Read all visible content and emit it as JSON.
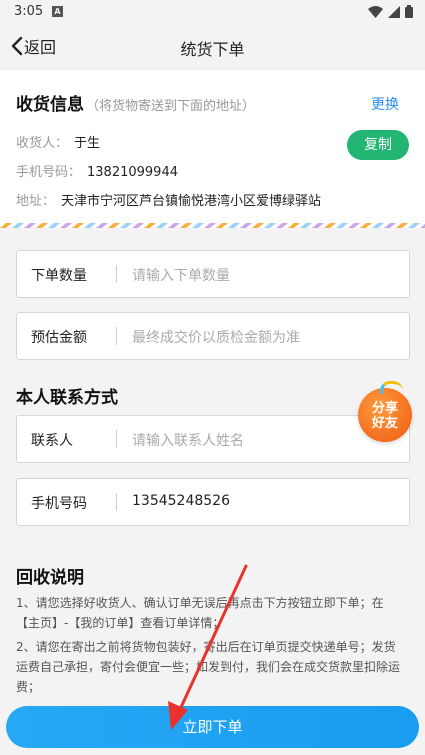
{
  "status_bar": {
    "time": "3:05",
    "app_icon_glyph": "A"
  },
  "nav": {
    "back_label": "返回",
    "title": "统货下单"
  },
  "address": {
    "heading": "收货信息",
    "hint": "（将货物寄送到下面的地址）",
    "change_label": "更换",
    "receiver_label": "收货人：",
    "receiver_value": "于生",
    "phone_label": "手机号码：",
    "phone_value": "13821099944",
    "address_label": "地址：",
    "address_value": "天津市宁河区芦台镇愉悦港湾小区爱博绿驿站",
    "copy_label": "复制"
  },
  "order": {
    "quantity_label": "下单数量",
    "quantity_placeholder": "请输入下单数量",
    "amount_label": "预估金额",
    "amount_placeholder": "最终成交价以质检金额为准"
  },
  "contact": {
    "heading": "本人联系方式",
    "name_label": "联系人",
    "name_placeholder": "请输入联系人姓名",
    "phone_label": "手机号码",
    "phone_value": "13545248526"
  },
  "share_badge": {
    "line1": "分享",
    "line2": "好友"
  },
  "notes": {
    "heading": "回收说明",
    "item1": "1、请您选择好收货人、确认订单无误后再点击下方按钮立即下单；在【主页】-【我的订单】查看订单详情；",
    "item2": "2、请您在寄出之前将货物包装好，寄出后在订单页提交快递单号；发货运费自己承担，寄付会便宜一些；如发到付，我们会在成交货款里扣除运费；"
  },
  "submit": {
    "label": "立即下单"
  },
  "colors": {
    "accent_blue": "#1a9cf0",
    "copy_green": "#22b573",
    "annotation_red": "#e8322b",
    "share_orange": "#ee5a12"
  }
}
